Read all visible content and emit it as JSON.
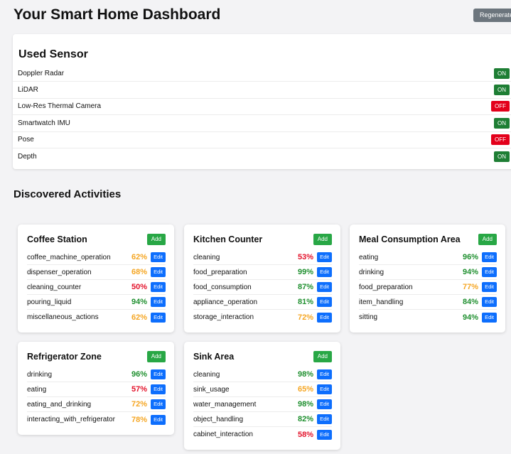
{
  "header": {
    "title": "Your Smart Home Dashboard",
    "regenerate_label": "Regenerate"
  },
  "sensors": {
    "title": "Used Sensor",
    "items": [
      {
        "name": "Doppler Radar",
        "state": "ON"
      },
      {
        "name": "LiDAR",
        "state": "ON"
      },
      {
        "name": "Low-Res Thermal Camera",
        "state": "OFF"
      },
      {
        "name": "Smartwatch IMU",
        "state": "ON"
      },
      {
        "name": "Pose",
        "state": "OFF"
      },
      {
        "name": "Depth",
        "state": "ON"
      }
    ]
  },
  "activities": {
    "title": "Discovered Activities",
    "add_label": "Add",
    "edit_label": "Edit",
    "colors": {
      "high": "#1e8f2e",
      "mid": "#f5a623",
      "low": "#e3132b"
    },
    "zones": [
      {
        "name": "Coffee Station",
        "items": [
          {
            "name": "coffee_machine_operation",
            "pct": "62%",
            "level": "mid"
          },
          {
            "name": "dispenser_operation",
            "pct": "68%",
            "level": "mid"
          },
          {
            "name": "cleaning_counter",
            "pct": "50%",
            "level": "low"
          },
          {
            "name": "pouring_liquid",
            "pct": "94%",
            "level": "high"
          },
          {
            "name": "miscellaneous_actions",
            "pct": "62%",
            "level": "mid"
          }
        ]
      },
      {
        "name": "Kitchen Counter",
        "items": [
          {
            "name": "cleaning",
            "pct": "53%",
            "level": "low"
          },
          {
            "name": "food_preparation",
            "pct": "99%",
            "level": "high"
          },
          {
            "name": "food_consumption",
            "pct": "87%",
            "level": "high"
          },
          {
            "name": "appliance_operation",
            "pct": "81%",
            "level": "high"
          },
          {
            "name": "storage_interaction",
            "pct": "72%",
            "level": "mid"
          }
        ]
      },
      {
        "name": "Meal Consumption Area",
        "items": [
          {
            "name": "eating",
            "pct": "96%",
            "level": "high"
          },
          {
            "name": "drinking",
            "pct": "94%",
            "level": "high"
          },
          {
            "name": "food_preparation",
            "pct": "77%",
            "level": "mid"
          },
          {
            "name": "item_handling",
            "pct": "84%",
            "level": "high"
          },
          {
            "name": "sitting",
            "pct": "94%",
            "level": "high"
          }
        ]
      },
      {
        "name": "Refrigerator Zone",
        "items": [
          {
            "name": "drinking",
            "pct": "96%",
            "level": "high"
          },
          {
            "name": "eating",
            "pct": "57%",
            "level": "low"
          },
          {
            "name": "eating_and_drinking",
            "pct": "72%",
            "level": "mid"
          },
          {
            "name": "interacting_with_refrigerator",
            "pct": "78%",
            "level": "mid"
          }
        ]
      },
      {
        "name": "Sink Area",
        "items": [
          {
            "name": "cleaning",
            "pct": "98%",
            "level": "high"
          },
          {
            "name": "sink_usage",
            "pct": "65%",
            "level": "mid"
          },
          {
            "name": "water_management",
            "pct": "98%",
            "level": "high"
          },
          {
            "name": "object_handling",
            "pct": "82%",
            "level": "high"
          },
          {
            "name": "cabinet_interaction",
            "pct": "58%",
            "level": "low"
          }
        ]
      }
    ]
  }
}
